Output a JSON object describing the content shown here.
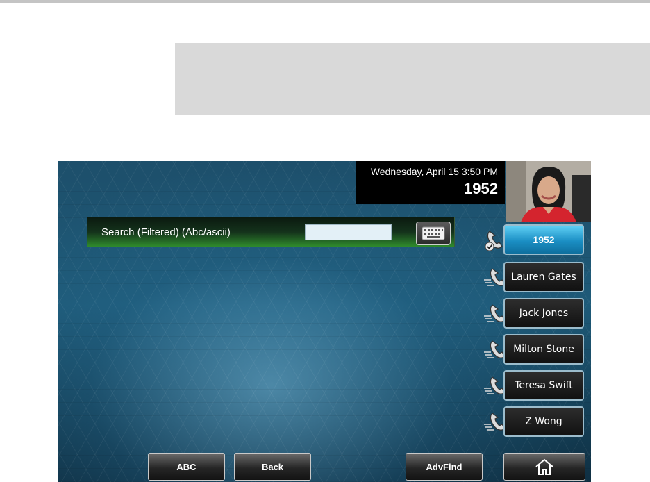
{
  "status": {
    "datetime": "Wednesday, April 15  3:50 PM",
    "line_number": "1952"
  },
  "search": {
    "label": "Search (Filtered) (Abc/ascii)",
    "value": ""
  },
  "lines": [
    {
      "label": "1952",
      "active": true,
      "icon": "handset-checked-icon"
    },
    {
      "label": "Lauren Gates",
      "active": false,
      "icon": "handset-speed-dial-icon"
    },
    {
      "label": "Jack Jones",
      "active": false,
      "icon": "handset-speed-dial-icon"
    },
    {
      "label": "Milton Stone",
      "active": false,
      "icon": "handset-speed-dial-icon"
    },
    {
      "label": "Teresa Swift",
      "active": false,
      "icon": "handset-speed-dial-icon"
    },
    {
      "label": "Z Wong",
      "active": false,
      "icon": "handset-speed-dial-icon"
    }
  ],
  "softkeys": {
    "abc": "ABC",
    "back": "Back",
    "advfind": "AdvFind",
    "home_icon": "home-icon"
  },
  "colors": {
    "active_key": "#1b8fc4",
    "search_bar": "#2f8a2c"
  }
}
